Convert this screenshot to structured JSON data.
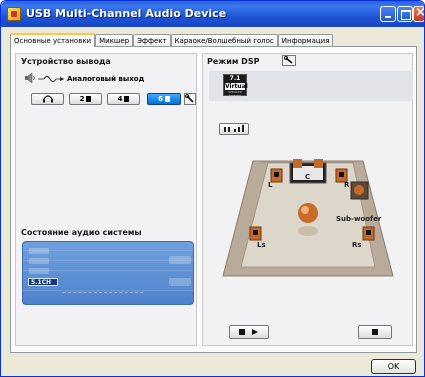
{
  "window": {
    "title": "USB Multi-Channel Audio Device"
  },
  "tabs": [
    {
      "label": "Основные установки",
      "active": true
    },
    {
      "label": "Микшер",
      "active": false
    },
    {
      "label": "Эффект",
      "active": false
    },
    {
      "label": "Караоке/Волшебный голос",
      "active": false
    },
    {
      "label": "Информация",
      "active": false
    }
  ],
  "output": {
    "title": "Устройство вывода",
    "analog_label": "Аналоговый выход",
    "options": [
      {
        "label": "",
        "icon": "headphones-icon",
        "active": false
      },
      {
        "label": "2",
        "icon": "speaker-icon",
        "active": false
      },
      {
        "label": "4",
        "icon": "speaker-icon",
        "active": false
      },
      {
        "label": "6",
        "icon": "speaker-icon",
        "active": true
      }
    ]
  },
  "status": {
    "title": "Состояние аудио системы",
    "channel": "5.1CH"
  },
  "dsp": {
    "title": "Режим DSP",
    "virtual_icon": {
      "line1": "7.1",
      "line2": "Virtual",
      "line3": "SPEAKER SHIFTER"
    }
  },
  "room": {
    "labels": {
      "left": "L",
      "center": "C",
      "right": "R",
      "subwoofer": "Sub-woofer",
      "left_surround": "Ls",
      "right_surround": "Rs"
    }
  },
  "footer": {
    "ok_label": "OK"
  },
  "colors": {
    "title_bar": "#2458d6",
    "active_tab_accent": "#ffc83c",
    "active_option": "#0a7ee0",
    "status_panel": "#5d8fd6",
    "room_floor": "#b8ab9a"
  }
}
